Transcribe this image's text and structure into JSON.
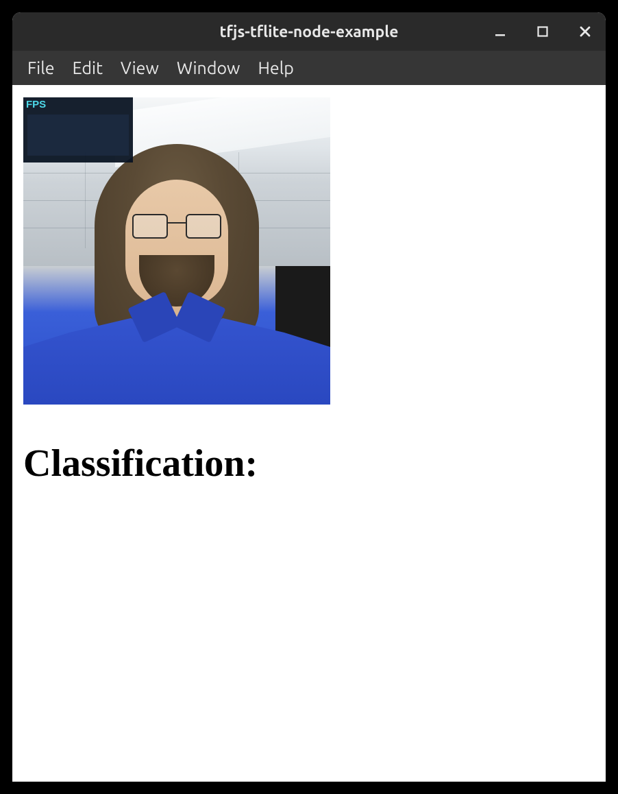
{
  "window": {
    "title": "tfjs-tflite-node-example"
  },
  "menubar": {
    "items": [
      {
        "label": "File"
      },
      {
        "label": "Edit"
      },
      {
        "label": "View"
      },
      {
        "label": "Window"
      },
      {
        "label": "Help"
      }
    ]
  },
  "fps_overlay": {
    "label": "FPS"
  },
  "content": {
    "classification_heading": "Classification:"
  }
}
